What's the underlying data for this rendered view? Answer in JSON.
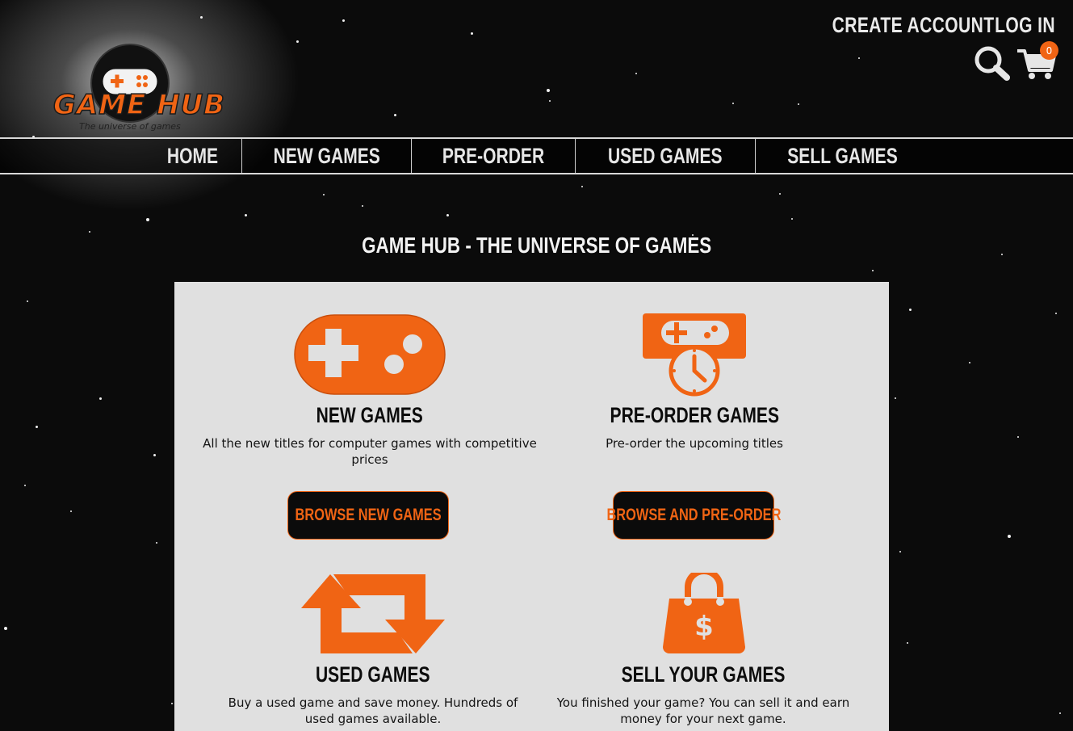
{
  "brand": {
    "name": "GAME HUB",
    "tagline": "The universe of games",
    "accent_color": "#f06414"
  },
  "header": {
    "links": [
      {
        "label": "CREATE ACCOUNT"
      },
      {
        "label": "LOG IN"
      }
    ],
    "search_icon": "search-icon",
    "cart_icon": "cart-icon",
    "cart_count": "0"
  },
  "nav": {
    "items": [
      {
        "label": "HOME"
      },
      {
        "label": "NEW GAMES"
      },
      {
        "label": "PRE-ORDER"
      },
      {
        "label": "USED GAMES"
      },
      {
        "label": "SELL GAMES"
      }
    ]
  },
  "main": {
    "headline": "GAME HUB - THE UNIVERSE OF GAMES",
    "features": [
      {
        "icon": "gamepad-icon",
        "title": "NEW GAMES",
        "description": "All the new titles for computer games with competitive prices",
        "button": "BROWSE NEW GAMES"
      },
      {
        "icon": "preorder-clock-icon",
        "title": "PRE-ORDER GAMES",
        "description": "Pre-order the upcoming titles",
        "button": "BROWSE AND PRE-ORDER"
      },
      {
        "icon": "exchange-arrows-icon",
        "title": "USED GAMES",
        "description": "Buy a used game and save money. Hundreds of used games available."
      },
      {
        "icon": "shopping-bag-dollar-icon",
        "title": "SELL YOUR GAMES",
        "description": "You finished your game? You can sell it and earn money for your next game."
      }
    ]
  }
}
